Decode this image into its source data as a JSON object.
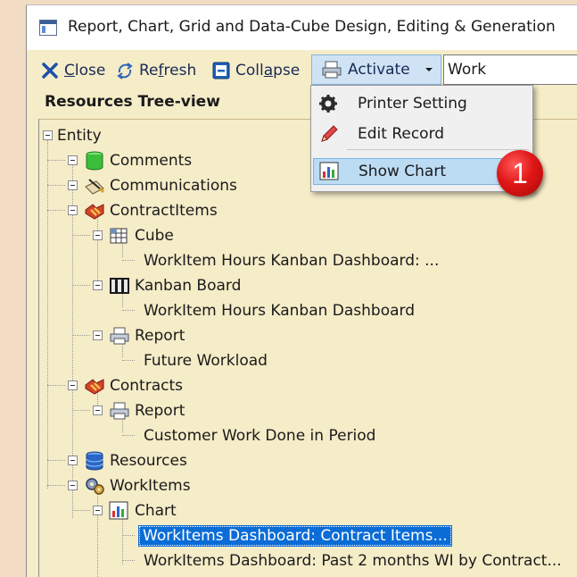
{
  "window": {
    "title": "Report, Chart, Grid and Data-Cube Design, Editing & Generation"
  },
  "toolbar": {
    "close": {
      "u": "C",
      "rest": "lose"
    },
    "refresh": {
      "pre": "Re",
      "u": "f",
      "rest": "resh"
    },
    "collapse": {
      "pre": "Coll",
      "u": "a",
      "rest": "pse"
    },
    "activate": {
      "u": "A",
      "rest": "ctivate"
    },
    "search_value": "Work"
  },
  "panel": {
    "title": "Resources Tree-view"
  },
  "tree": {
    "entity": "Entity",
    "comments": "Comments",
    "communications": "Communications",
    "contract_items": "ContractItems",
    "cube": "Cube",
    "cube_child": "WorkItem Hours Kanban Dashboard: ...",
    "kanban": "Kanban Board",
    "kanban_child": "WorkItem Hours Kanban Dashboard",
    "report1": "Report",
    "report1_child": "Future Workload",
    "contracts": "Contracts",
    "report2": "Report",
    "report2_child": "Customer Work Done in Period",
    "resources": "Resources",
    "workitems": "WorkItems",
    "chart": "Chart",
    "chart_child1": "WorkItems Dashboard: Contract Items...",
    "chart_child2": "WorkItems Dashboard: Past 2 months WI by Contract..."
  },
  "menu": {
    "printer_setting": "Printer Setting",
    "edit_record": "Edit Record",
    "show_chart": "Show Chart"
  },
  "badge": "1",
  "colors": {
    "accent": "#0b6cd6",
    "badge": "#e01616",
    "tree_bg": "#f5ecc8"
  }
}
